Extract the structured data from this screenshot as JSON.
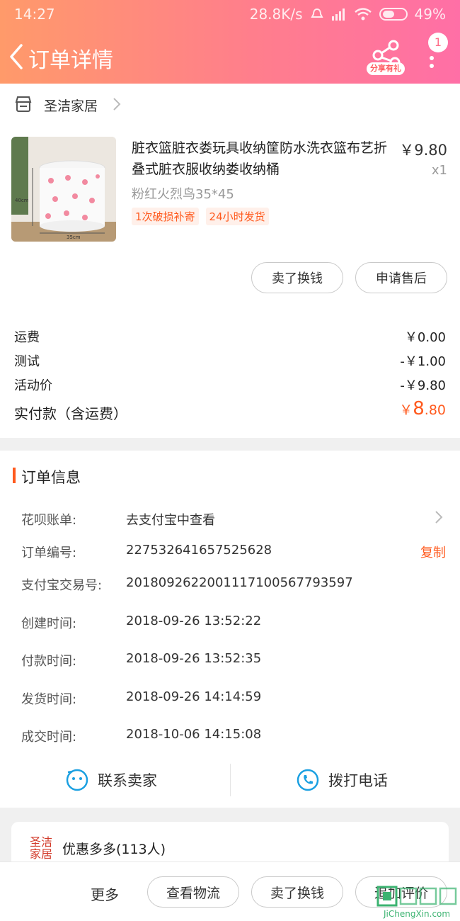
{
  "status_bar": {
    "time": "14:27",
    "network_speed": "28.8K/s",
    "battery": "49%"
  },
  "header": {
    "title": "订单详情",
    "share_badge": "分享有礼",
    "notification_count": "1"
  },
  "shop": {
    "name": "圣洁家居"
  },
  "product": {
    "name": "脏衣篮脏衣娄玩具收纳筐防水洗衣篮布艺折叠式脏衣服收纳娄收纳桶",
    "price": "￥9.80",
    "quantity": "x1",
    "variant": "粉红火烈鸟35*45",
    "tags": [
      "1次破损补寄",
      "24小时发货"
    ],
    "image_labels": {
      "height": "40cm",
      "width": "35cm"
    },
    "buttons": {
      "sell": "卖了换钱",
      "after_sale": "申请售后"
    }
  },
  "fees": [
    {
      "label": "运费",
      "value": "￥0.00"
    },
    {
      "label": "测试",
      "value": "-￥1.00"
    },
    {
      "label": "活动价",
      "value": "-￥9.80"
    }
  ],
  "total": {
    "label": "实付款（含运费）",
    "currency": "￥",
    "main": "8",
    "decimal": ".80"
  },
  "order_info": {
    "title": "订单信息",
    "rows": [
      {
        "label": "花呗账单:",
        "value": "去支付宝中查看"
      },
      {
        "label": "订单编号:",
        "value": "227532641657525628",
        "action": "复制"
      },
      {
        "label": "支付宝交易号:",
        "value": "2018092622001117100567793597"
      },
      {
        "label": "创建时间:",
        "value": "2018-09-26 13:52:22"
      },
      {
        "label": "付款时间:",
        "value": "2018-09-26 13:52:35"
      },
      {
        "label": "发货时间:",
        "value": "2018-09-26 14:14:59"
      },
      {
        "label": "成交时间:",
        "value": "2018-10-06 14:15:08"
      }
    ],
    "contact_seller": "联系卖家",
    "call_phone": "拨打电话"
  },
  "recommend": {
    "logo_text": "圣洁家居",
    "text": "优惠多多(113人)"
  },
  "bottom_bar": {
    "more": "更多",
    "logistics": "查看物流",
    "sell": "卖了换钱",
    "review": "追加评价"
  },
  "watermark": {
    "brand": "JiChengXin.com"
  },
  "colors": {
    "accent": "#ff5a1e",
    "header_start": "#ff9a6a",
    "header_end": "#ff6fa6"
  }
}
